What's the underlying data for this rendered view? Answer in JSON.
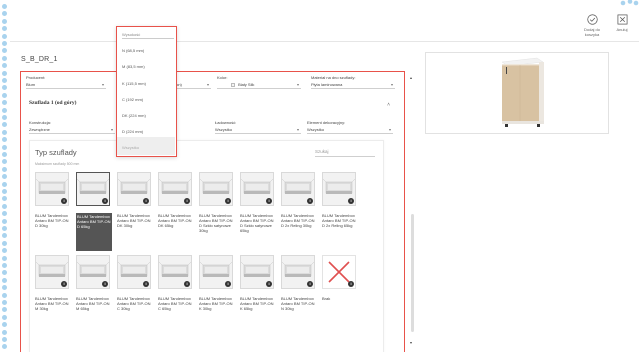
{
  "topbar": {
    "add_to_cart_label": "Dodaj do koszyka",
    "cancel_label": "Anuluj"
  },
  "page_title": "S_B_DR_1",
  "filters": {
    "producer_label": "Producent:",
    "producer_value": "Blum",
    "height_value": "ton)",
    "color_label": "Kolor:",
    "color_value": "Biały Silk",
    "material_label": "Materiał na dno szuflady:",
    "material_value": "Płyta laminowana"
  },
  "section": {
    "title": "Szuflada 1 (od góry)",
    "construction_label": "Konstrukcja:",
    "construction_value": "Zewnętrzne",
    "capacity_label": "Ładowność:",
    "capacity_value": "Wszystko",
    "extra_label": "Element dekoracyjny:",
    "extra_value": "Wszystko"
  },
  "card": {
    "title": "Typ szuflady",
    "subtitle": "Maksimum szuflady 500 mm",
    "search_placeholder": "Szukaj"
  },
  "tiles": [
    {
      "label": "BLUM Tandembox Antaro BM TIP-ON D 30kg"
    },
    {
      "label": "BLUM Tandembox Antaro BM TIP-ON D 65kg"
    },
    {
      "label": "BLUM Tandembox Antaro BM TIP-ON DK 30kg"
    },
    {
      "label": "BLUM Tandembox Antaro BM TIP-ON DK 65kg"
    },
    {
      "label": "BLUM Tandembox Antaro BM TIP-ON D Szkło satynowe 30kg"
    },
    {
      "label": "BLUM Tandembox Antaro BM TIP-ON D Szkło satynowe 65kg"
    },
    {
      "label": "BLUM Tandembox Antaro BM TIP-ON D 2x Reling 30kg"
    },
    {
      "label": "BLUM Tandembox Antaro BM TIP-ON D 2x Reling 65kg"
    },
    {
      "label": "BLUM Tandembox Antaro BM TIP-ON M 30kg"
    },
    {
      "label": "BLUM Tandembox Antaro BM TIP-ON M 65kg"
    },
    {
      "label": "BLUM Tandembox Antaro BM TIP-ON C 30kg"
    },
    {
      "label": "BLUM Tandembox Antaro BM TIP-ON C 65kg"
    },
    {
      "label": "BLUM Tandembox Antaro BM TIP-ON K 30kg"
    },
    {
      "label": "BLUM Tandembox Antaro BM TIP-ON K 65kg"
    },
    {
      "label": "BLUM Tandembox Antaro BM TIP-ON N 30kg"
    },
    {
      "label": "Brak"
    }
  ],
  "dropdown": {
    "items": [
      "Wysokość",
      "N (68,5 mm)",
      "M (83,5 mm)",
      "K (115,5 mm)",
      "C (192 mm)",
      "DK (224 mm)",
      "D (224 mm)",
      "Wszystko"
    ]
  },
  "colors": {
    "accent": "#e8524a",
    "dots": "#a9d3ee",
    "selected_tile": "#555555"
  }
}
